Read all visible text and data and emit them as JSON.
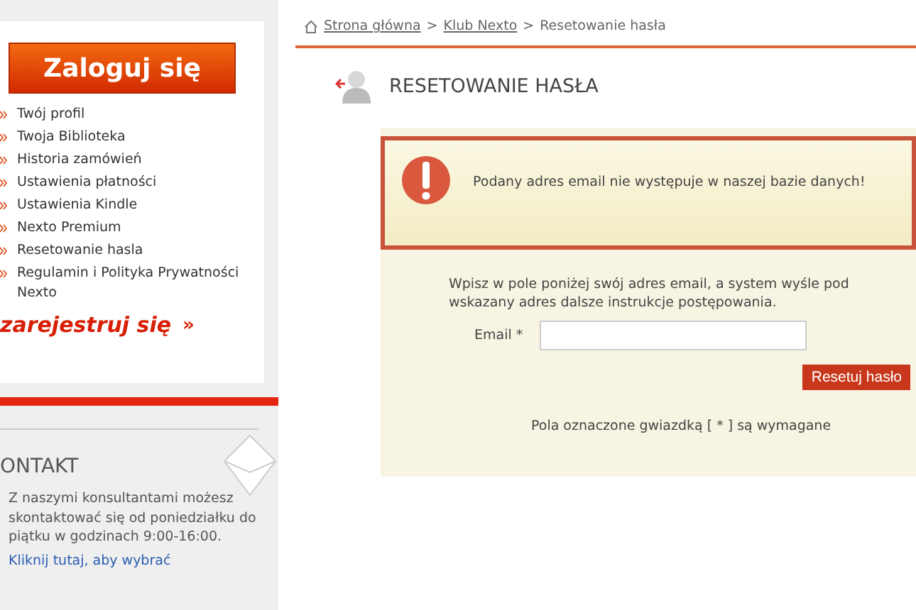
{
  "sidebar": {
    "login_button": "Zaloguj się",
    "menu": [
      "Twój profil",
      "Twoja Biblioteka",
      "Historia zamówień",
      "Ustawienia płatności",
      "Ustawienia Kindle",
      "Nexto Premium",
      "Resetowanie hasla",
      "Regulamin i Polityka Prywatności Nexto"
    ],
    "register_link": "zarejestruj się",
    "register_arrow": "»",
    "contact": {
      "title": "ONTAKT",
      "text": "Z naszymi konsultantami możesz skontaktować się od poniedziałku do piątku w godzinach 9:00-16:00.",
      "link": "Kliknij tutaj, aby wybrać"
    }
  },
  "breadcrumb": {
    "links": [
      "Strona główna",
      "Klub Nexto"
    ],
    "separator": ">",
    "current": "Resetowanie hasła"
  },
  "page_title": "RESETOWANIE HASŁA",
  "alert": {
    "message": "Podany adres email nie występuje w naszej bazie danych!"
  },
  "form": {
    "intro": "Wpisz w pole poniżej swój adres email, a system wyśle pod wskazany adres dalsze instrukcje postępowania.",
    "email_label": "Email *",
    "submit": "Resetuj hasło",
    "note": "Pola oznaczone gwiazdką [ * ] są wymagane"
  }
}
